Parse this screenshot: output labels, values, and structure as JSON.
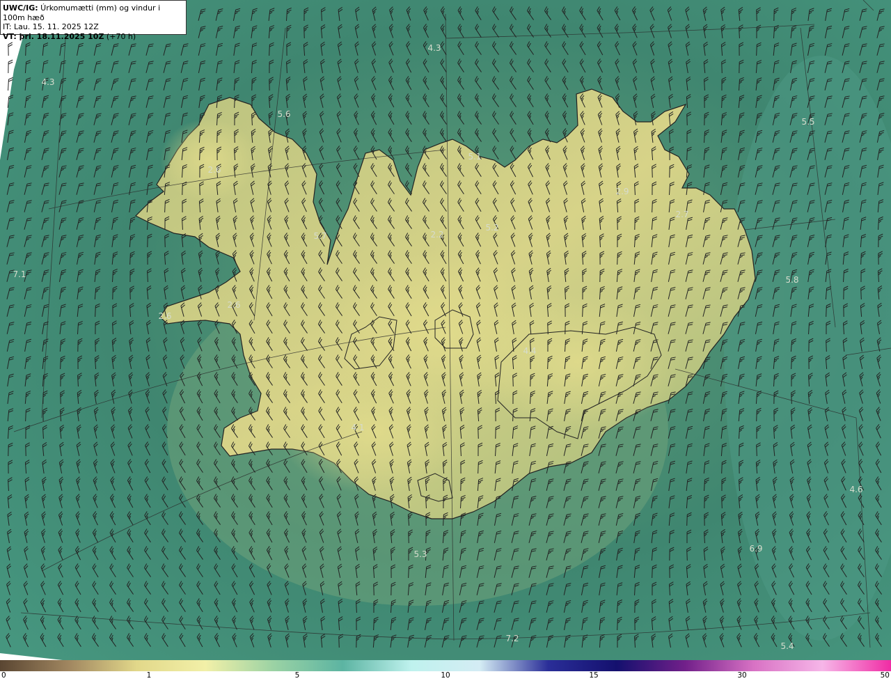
{
  "header": {
    "line1_bold": "UWC/IG:",
    "line1_rest": " Úrkomumætti (mm) og vindur i 100m hæð",
    "line2": "IT: Lau. 15. 11. 2025 12Z",
    "line3_bold": "VT: þri. 18.11.2025 10Z",
    "line3_rest": " (+70 h)"
  },
  "colorbar": {
    "ticks": [
      "0",
      "1",
      "5",
      "10",
      "15",
      "30",
      "50"
    ],
    "stops": [
      "#5a4632",
      "#a08660",
      "#e2d88a",
      "#f2f0a8",
      "#9ad2a4",
      "#5cb4a2",
      "#bff2ee",
      "#d4ecf4",
      "#2a2e98",
      "#14106e",
      "#72208a",
      "#d872c4",
      "#f6b6e8",
      "#f02ca4"
    ]
  },
  "map_labels": [
    "4.3",
    "4.3",
    "5.6",
    "5.5",
    "5.1",
    "2.6",
    "2.9",
    "2.7",
    "5.7",
    "2.2",
    "5.2",
    "7.1",
    "5.8",
    "2.6",
    "2.6",
    "4.4",
    "4.1",
    "4.6",
    "5.3",
    "6.9",
    "7.2",
    "5.4"
  ],
  "colors": {
    "sea": "#3f8670",
    "land_high": "#dcd48a",
    "coastline": "#222222"
  }
}
